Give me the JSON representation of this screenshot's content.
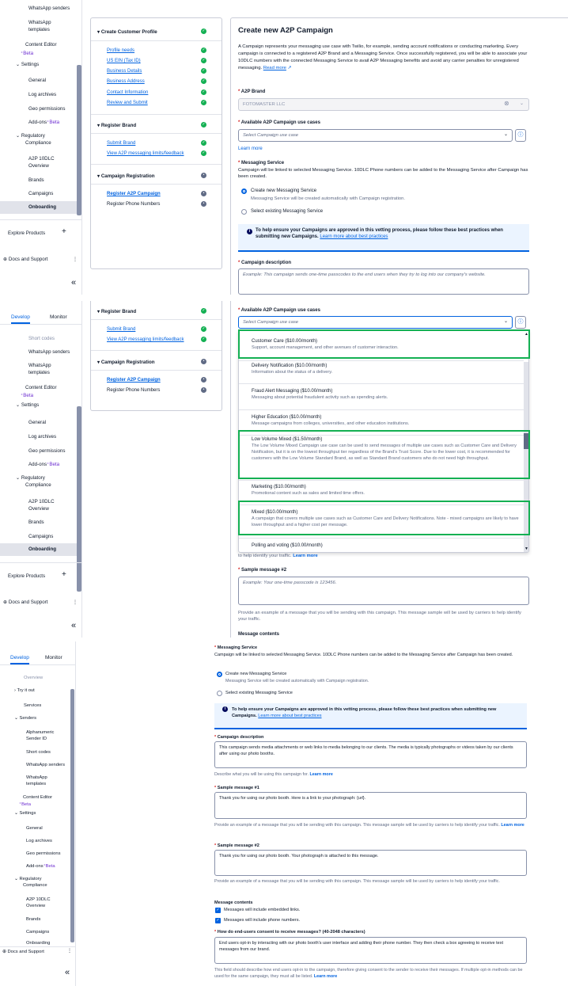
{
  "tabs": {
    "develop": "Develop",
    "monitor": "Monitor"
  },
  "sidebar1": {
    "items": [
      "WhatsApp senders",
      "WhatsApp",
      "templates",
      "Content Editor",
      "Beta",
      "Settings",
      "General",
      "Log archives",
      "Geo permissions",
      "Add-ons",
      "Beta",
      "Regulatory",
      "Compliance",
      "A2P 10DLC",
      "Overview",
      "Brands",
      "Campaigns",
      "Onboarding"
    ],
    "explore": "Explore Products",
    "docs": "Docs and Support",
    "collapse": "«"
  },
  "sidebar2": {
    "items": [
      "Short codes",
      "WhatsApp senders",
      "WhatsApp",
      "templates",
      "Content Editor",
      "Beta",
      "Settings",
      "General",
      "Log archives",
      "Geo permissions",
      "Add-ons",
      "Beta",
      "Regulatory",
      "Compliance",
      "A2P 10DLC",
      "Overview",
      "Brands",
      "Campaigns",
      "Onboarding"
    ],
    "explore": "Explore Products",
    "docs": "Docs and Support",
    "collapse": "«"
  },
  "sidebar3": {
    "items": [
      "Overview",
      "Try it out",
      "Services",
      "Senders",
      "Alphanumeric",
      "Sender ID",
      "Short codes",
      "WhatsApp senders",
      "WhatsApp",
      "templates",
      "Content Editor",
      "Beta",
      "Settings",
      "General",
      "Log archives",
      "Geo permissions",
      "Add-ons",
      "Beta",
      "Regulatory",
      "Compliance",
      "A2P 10DLC",
      "Overview",
      "Brands",
      "Campaigns",
      "Onboarding"
    ],
    "docs": "Docs and Support",
    "collapse": "«"
  },
  "steps": {
    "create_profile": "Create Customer Profile",
    "profile_links": [
      "Profile needs",
      "US EIN (Tax ID)",
      "Business Details",
      "Business Address",
      "Contact Information",
      "Review and Submit"
    ],
    "register_brand": "Register Brand",
    "submit_brand": "Submit Brand",
    "view_limits": "View A2P messaging limits/feedback",
    "campaign_registration": "Campaign Registration",
    "register_campaign": "Register A2P Campaign",
    "register_numbers": "Register Phone Numbers"
  },
  "form": {
    "title": "Create new A2P Campaign",
    "intro": "A Campaign represents your messaging use case with Twilio, for example, sending account notifications or conducting marketing. Every campaign is connected to a registered A2P Brand and a Messaging Service. Once successfully registered, you will be able to associate your 10DLC numbers with the connected Messaging Service to avail A2P Messaging benefits and avoid any carrier penalties for unregistered messaging.",
    "read_more": "Read more",
    "brand_label": "A2P Brand",
    "brand_value": "FOTOMASTER LLC",
    "usecase_label": "Available A2P Campaign use cases",
    "usecase_placeholder": "Select Campaign use case",
    "learn_more": "Learn more",
    "ms_label": "Messaging Service",
    "ms_help": "Campaign will be linked to selected Messaging Service. 10DLC Phone numbers can be added to the Messaging Service after Campaign has been created.",
    "ms_create": "Create new Messaging Service",
    "ms_create_help": "Messaging Service will be created automatically with Campaign registration.",
    "ms_existing": "Select existing Messaging Service",
    "notice": "To help ensure your Campaigns are approved in this vetting process, please follow these best practices when submitting new Campaigns.",
    "notice_link": "Learn more about best practices",
    "desc_label": "Campaign description",
    "desc_placeholder": "Example: This campaign sends one-time passcodes to the end users when they try to log into our company's website.",
    "desc_value": "This campaign sends media attachments or web links to media belonging to our clients. The media is typically photographs or videos taken by our clients after using our photo booths.",
    "desc_help": "Describe what you will be using this campaign for.",
    "sample1_label": "Sample message #1",
    "sample1_value": "Thank you for using our photo booth. Here is a link to your photograph: {url}.",
    "sample_help": "Provide an example of a message that you will be sending with this campaign. This message sample will be used by carriers to help identify your traffic.",
    "sample_help_tail": "to help identify your traffic.",
    "sample2_label": "Sample message #2",
    "sample2_placeholder": "Example: Your one-time passcode is 123456.",
    "sample2_value": "Thank you for using our photo booth. Your photograph is attached to this message.",
    "contents_label": "Message contents",
    "contents_links": "Messages will include embedded links.",
    "contents_phones": "Messages will include phone numbers.",
    "consent_label": "How do end-users consent to receive messages? (40-2048 characters)",
    "consent_value": "End users opt-in by interacting with our photo booth's user interface and adding their phone number. They then check a box agreeing to receive text messages from our brand.",
    "consent_help": "This field should describe how end users opt-in to the campaign, therefore giving consent to the sender to receive their messages. If multiple opt-in methods can be used for the same campaign, they must all be listed."
  },
  "usecases": [
    {
      "title": "Customer Care ($10.00/month)",
      "desc": "Support, account management, and other avenues of customer interaction."
    },
    {
      "title": "Delivery Notification ($10.00/month)",
      "desc": "Information about the status of a delivery."
    },
    {
      "title": "Fraud Alert Messaging ($10.00/month)",
      "desc": "Messaging about potential fraudulent activity such as spending alerts."
    },
    {
      "title": "Higher Education ($10.00/month)",
      "desc": "Message campaigns from colleges, universities, and other education institutions."
    },
    {
      "title": "Low Volume Mixed ($1.50/month)",
      "desc": "The Low Volume Mixed Campaign use case can be used to send messages of multiple use cases such as Customer Care and Delivery Notification, but it is on the lowest throughput tier regardless of the Brand's Trust Score. Due to the lower cost, it is recommended for customers with the Low Volume Standard Brand, as well as Standard Brand customers who do not need high throughput."
    },
    {
      "title": "Marketing ($10.00/month)",
      "desc": "Promotional content such as sales and limited time offers."
    },
    {
      "title": "Mixed ($10.00/month)",
      "desc": "A campaign that covers multiple use cases such as Customer Care and Delivery Notifications. Note - mixed campaigns are likely to have lower throughput and a higher cost per message."
    },
    {
      "title": "Polling and voting ($10.00/month)",
      "desc": ""
    }
  ],
  "colors": {
    "accent": "#0263e0",
    "success": "#14b053",
    "highlight": "#14b053"
  }
}
